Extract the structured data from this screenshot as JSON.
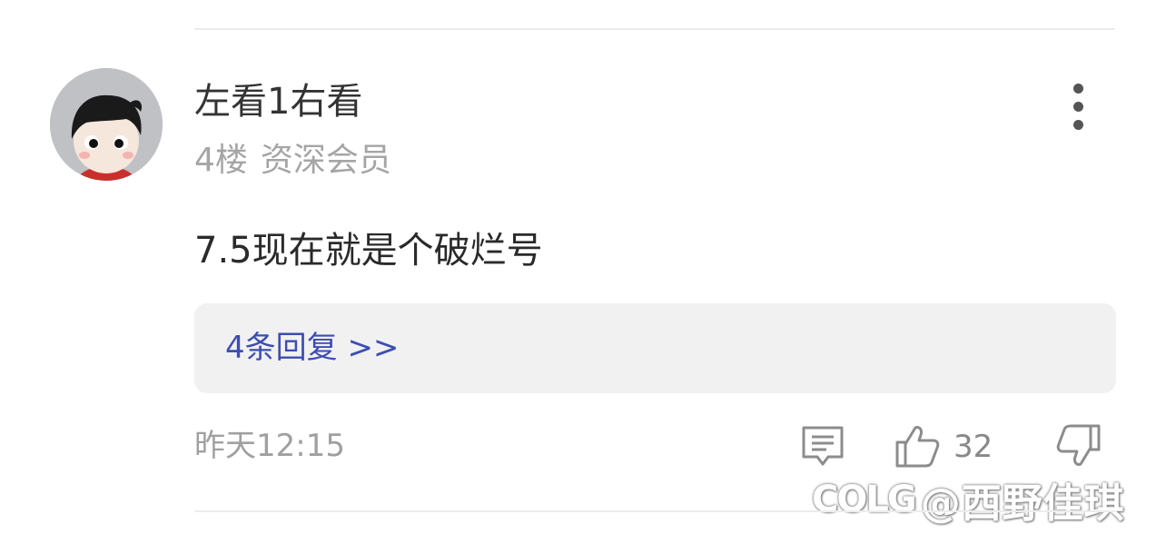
{
  "comment": {
    "username": "左看1右看",
    "floor": "4楼",
    "rank": "资深会员",
    "content": "7.5现在就是个破烂号",
    "replies_link": "4条回复 >>",
    "time": "昨天12:15",
    "like_count": "32"
  },
  "icons": {
    "more": "more-vertical-icon",
    "comment": "comment-icon",
    "like": "thumbs-up-icon",
    "dislike": "thumbs-down-icon"
  },
  "watermark": {
    "logo": "COLG",
    "text": "@西野佳琪"
  },
  "colors": {
    "link": "#3d4db1",
    "reply_box_bg": "#f1f1f1",
    "meta_text": "#a5a5a5"
  }
}
